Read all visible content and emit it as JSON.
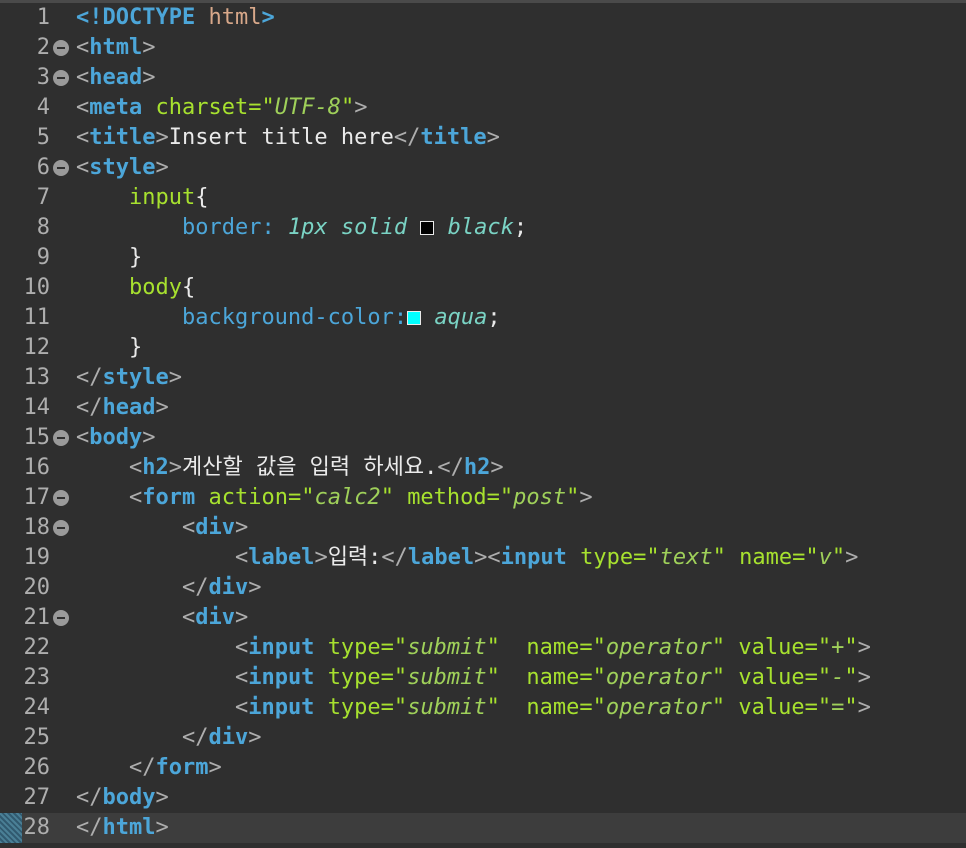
{
  "editor": {
    "line_numbers": [
      "1",
      "2",
      "3",
      "4",
      "5",
      "6",
      "7",
      "8",
      "9",
      "10",
      "11",
      "12",
      "13",
      "14",
      "15",
      "16",
      "17",
      "18",
      "19",
      "20",
      "21",
      "22",
      "23",
      "24",
      "25",
      "26",
      "27",
      "28"
    ],
    "lines": {
      "l1": {
        "open": "<!",
        "doctype": "DOCTYPE",
        "html": "html",
        "close": ">"
      },
      "l2": {
        "tag": "html"
      },
      "l3": {
        "tag": "head"
      },
      "l4": {
        "tag": "meta",
        "attr": "charset",
        "value": "UTF-8"
      },
      "l5": {
        "tag": "title",
        "text": "Insert title here"
      },
      "l6": {
        "tag": "style"
      },
      "l7": {
        "selector": "input",
        "brace": "{"
      },
      "l8": {
        "prop": "border:",
        "value1": "1px solid",
        "value2": "black",
        "semi": ";",
        "swatch": "#000000"
      },
      "l9": {
        "brace": "}"
      },
      "l10": {
        "selector": "body",
        "brace": "{"
      },
      "l11": {
        "prop": "background-color:",
        "value": "aqua",
        "semi": ";",
        "swatch": "#00ffff"
      },
      "l12": {
        "brace": "}"
      },
      "l13": {
        "tag": "style"
      },
      "l14": {
        "tag": "head"
      },
      "l15": {
        "tag": "body"
      },
      "l16": {
        "tag": "h2",
        "text": "계산할 값을 입력 하세요."
      },
      "l17": {
        "tag": "form",
        "attr1": "action",
        "value1": "calc2",
        "attr2": "method",
        "value2": "post"
      },
      "l18": {
        "tag": "div"
      },
      "l19": {
        "tag1": "label",
        "text": "입력:",
        "tag2": "input",
        "attr1": "type",
        "value1": "text",
        "attr2": "name",
        "value2": "v"
      },
      "l20": {
        "tag": "div"
      },
      "l21": {
        "tag": "div"
      },
      "l22": {
        "tag": "input",
        "attr1": "type",
        "value1": "submit",
        "attr2": "name",
        "value2": "operator",
        "attr3": "value",
        "value3": "+"
      },
      "l23": {
        "tag": "input",
        "attr1": "type",
        "value1": "submit",
        "attr2": "name",
        "value2": "operator",
        "attr3": "value",
        "value3": "-"
      },
      "l24": {
        "tag": "input",
        "attr1": "type",
        "value1": "submit",
        "attr2": "name",
        "value2": "operator",
        "attr3": "value",
        "value3": "="
      },
      "l25": {
        "tag": "div"
      },
      "l26": {
        "tag": "form"
      },
      "l27": {
        "tag": "body"
      },
      "l28": {
        "tag": "html"
      }
    },
    "colors": {
      "background": "#2f2f2f",
      "tag": "#4ca6d9",
      "attribute": "#a7e12f",
      "value": "#9fd05a",
      "text": "#eaeaea",
      "punctuation": "#aeaeae",
      "doctype": "#d8a88a"
    }
  }
}
